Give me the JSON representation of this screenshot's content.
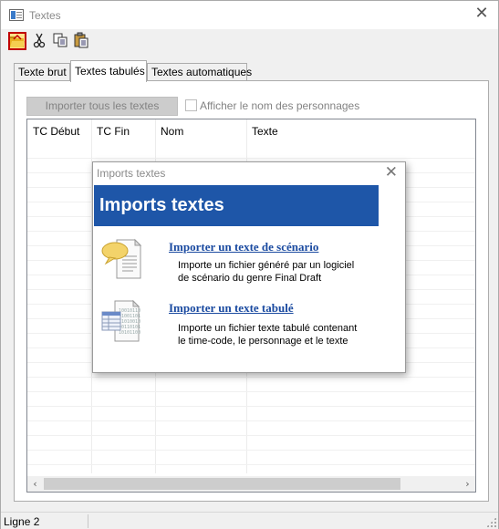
{
  "window": {
    "title": "Textes",
    "close_glyph": "✕"
  },
  "toolbar": {
    "buttons": [
      {
        "icon": "open-folder-icon"
      },
      {
        "icon": "cut-icon"
      },
      {
        "icon": "copy-icon"
      },
      {
        "icon": "paste-icon"
      }
    ]
  },
  "tabs": [
    {
      "label": "Texte brut",
      "active": false
    },
    {
      "label": "Textes tabulés",
      "active": true
    },
    {
      "label": "Textes automatiques",
      "active": false
    }
  ],
  "panel": {
    "import_all_label": "Importer tous les textes",
    "show_names_label": "Afficher le nom des personnages",
    "show_names_checked": false
  },
  "grid": {
    "columns": [
      "TC Début",
      "TC Fin",
      "Nom",
      "Texte"
    ]
  },
  "scrollbar": {
    "left_arrow": "‹",
    "right_arrow": "›"
  },
  "statusbar": {
    "text": "Ligne 2"
  },
  "dialog": {
    "title": "Imports textes",
    "close_glyph": "✕",
    "banner": "Imports textes",
    "options": [
      {
        "icon": "speech-document-icon",
        "link": "Importer un texte de scénario",
        "desc_line1": "Importe un fichier généré par un logiciel",
        "desc_line2": "de scénario du genre Final Draft"
      },
      {
        "icon": "tabbed-data-document-icon",
        "link": "Importer un texte tabulé",
        "desc_line1": "Importe un fichier texte tabulé contenant",
        "desc_line2": "le time-code, le personnage et le texte"
      }
    ]
  },
  "colors": {
    "banner_bg": "#1e56a8",
    "link": "#1a4aa0",
    "open_button_border": "#c00000"
  }
}
